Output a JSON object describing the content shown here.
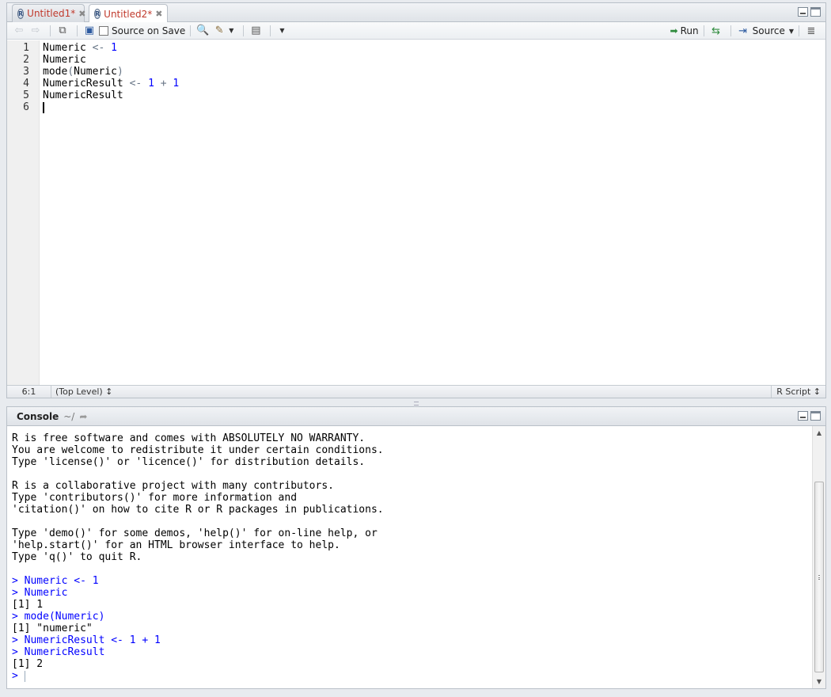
{
  "source": {
    "tabs": [
      {
        "label": "Untitled1*",
        "active": false
      },
      {
        "label": "Untitled2*",
        "active": true
      }
    ],
    "toolbar": {
      "source_on_save": "Source on Save",
      "run": "Run",
      "source": "Source"
    },
    "line_numbers": [
      "1",
      "2",
      "3",
      "4",
      "5",
      "6"
    ],
    "code": {
      "l1_a": "Numeric",
      "l1_op": "<-",
      "l1_num": "1",
      "l2": "Numeric",
      "l3_fn": "mode",
      "l3_p1": "(",
      "l3_arg": "Numeric",
      "l3_p2": ")",
      "l4_a": "NumericResult",
      "l4_op": "<-",
      "l4_n1": "1",
      "l4_plus": "+",
      "l4_n2": "1",
      "l5": "NumericResult"
    },
    "status": {
      "position": "6:1",
      "scope": "(Top Level) ↕",
      "file_type": "R Script ↕"
    }
  },
  "console": {
    "title": "Console",
    "path": "~/",
    "lines": {
      "l01": "R is free software and comes with ABSOLUTELY NO WARRANTY.",
      "l02": "You are welcome to redistribute it under certain conditions.",
      "l03": "Type 'license()' or 'licence()' for distribution details.",
      "l04": "R is a collaborative project with many contributors.",
      "l05": "Type 'contributors()' for more information and",
      "l06": "'citation()' on how to cite R or R packages in publications.",
      "l07": "Type 'demo()' for some demos, 'help()' for on-line help, or",
      "l08": "'help.start()' for an HTML browser interface to help.",
      "l09": "Type 'q()' to quit R.",
      "l10": "> Numeric <- 1",
      "l11": "> Numeric",
      "l12": "[1] 1",
      "l13": "> mode(Numeric)",
      "l14": "[1] \"numeric\"",
      "l15": "> NumericResult <- 1 + 1",
      "l16": "> NumericResult",
      "l17": "[1] 2",
      "prompt": ">"
    }
  },
  "colors": {
    "tab_label": "#c0392b",
    "console_input": "#0000ff",
    "code_number": "#0000ff",
    "run_arrow": "#2e8b3d"
  }
}
